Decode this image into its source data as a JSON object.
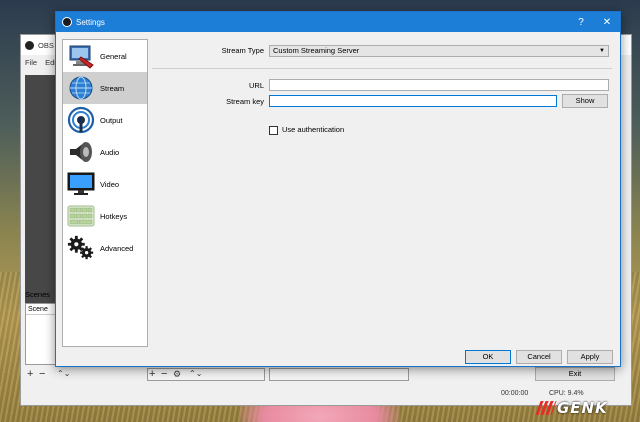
{
  "background_window": {
    "title": "OBS C",
    "menu": [
      "File",
      "Edi"
    ],
    "scenes_label": "Scenes",
    "scenes_header": "Scene",
    "exit_label": "Exit",
    "time": "00:00:00",
    "cpu": "CPU: 9.4%"
  },
  "dialog": {
    "title": "Settings",
    "help_glyph": "?",
    "close_glyph": "✕"
  },
  "sidebar": {
    "items": [
      {
        "label": "General",
        "icon": "general-icon",
        "selected": false
      },
      {
        "label": "Stream",
        "icon": "stream-globe-icon",
        "selected": true
      },
      {
        "label": "Output",
        "icon": "output-broadcast-icon",
        "selected": false
      },
      {
        "label": "Audio",
        "icon": "speaker-icon",
        "selected": false
      },
      {
        "label": "Video",
        "icon": "monitor-icon",
        "selected": false
      },
      {
        "label": "Hotkeys",
        "icon": "keyboard-icon",
        "selected": false
      },
      {
        "label": "Advanced",
        "icon": "gears-icon",
        "selected": false
      }
    ]
  },
  "stream": {
    "stream_type_label": "Stream Type",
    "stream_type_value": "Custom Streaming Server",
    "url_label": "URL",
    "url_value": "",
    "stream_key_label": "Stream key",
    "stream_key_value": "",
    "show_label": "Show",
    "use_auth_label": "Use authentication",
    "use_auth_checked": false
  },
  "footer": {
    "ok_label": "OK",
    "cancel_label": "Cancel",
    "apply_label": "Apply"
  },
  "watermark": {
    "text": "GENK"
  },
  "colors": {
    "accent": "#1c7ed6",
    "focus": "#0078d7",
    "selected": "#cfcfcf"
  }
}
